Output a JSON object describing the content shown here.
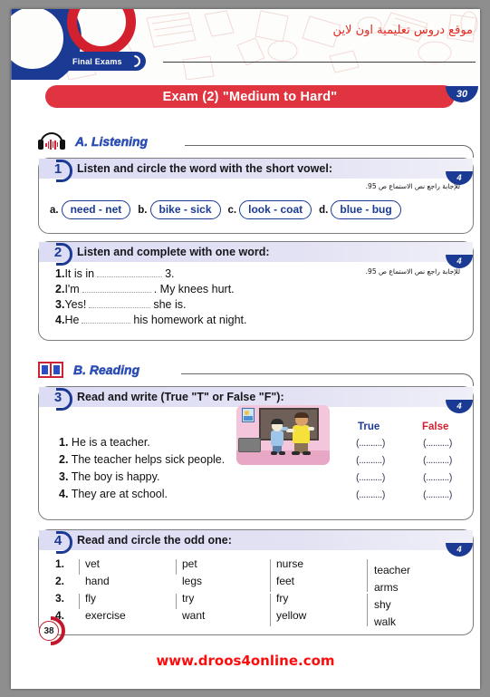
{
  "header": {
    "tab_label": "Final Exams",
    "arabic_site_text": "موقع دروس تعليمية اون لاين",
    "exam_title": "Exam (2) \"Medium to Hard\"",
    "total_mark": "30"
  },
  "sections": [
    {
      "id": "listening",
      "label": "A. Listening",
      "icon": "headphones-icon"
    },
    {
      "id": "reading",
      "label": "B. Reading",
      "icon": "open-book-icon"
    }
  ],
  "questions": {
    "q1": {
      "number": "1",
      "prompt": "Listen and circle the word with the short vowel:",
      "mark": "4",
      "arabic_note": "للإجابة راجع نص الاستماع ص 95.",
      "options": [
        {
          "letter": "a.",
          "text": "need - net"
        },
        {
          "letter": "b.",
          "text": "bike - sick"
        },
        {
          "letter": "c.",
          "text": "look - coat"
        },
        {
          "letter": "d.",
          "text": "blue - bug"
        }
      ]
    },
    "q2": {
      "number": "2",
      "prompt": "Listen and complete with one word:",
      "mark": "4",
      "arabic_note": "للإجابة راجع نص الاستماع ص 95.",
      "items": [
        {
          "num": "1.",
          "before": "It is in",
          "after": "3."
        },
        {
          "num": "2.",
          "before": "I'm",
          "after": ". My knees hurt."
        },
        {
          "num": "3.",
          "before": "Yes!",
          "after": "she is."
        },
        {
          "num": "4.",
          "before": "He",
          "after": "his homework at night."
        }
      ]
    },
    "q3": {
      "number": "3",
      "prompt": "Read and write (True \"T\" or False \"F\"):",
      "mark": "4",
      "col_true": "True",
      "col_false": "False",
      "answer_cell": "(..........)",
      "statements": [
        {
          "num": "1.",
          "text": "He is a teacher."
        },
        {
          "num": "2.",
          "text": "The teacher helps sick people."
        },
        {
          "num": "3.",
          "text": "The boy is happy."
        },
        {
          "num": "4.",
          "text": "They are at school."
        }
      ]
    },
    "q4": {
      "number": "4",
      "prompt": "Read and circle the odd one:",
      "mark": "4",
      "rows": [
        {
          "num": "1.",
          "w1": "vet",
          "w2": "pet",
          "w3": "nurse",
          "w4": "teacher"
        },
        {
          "num": "2.",
          "w1": "hand",
          "w2": "legs",
          "w3": "feet",
          "w4": "arms"
        },
        {
          "num": "3.",
          "w1": "fly",
          "w2": "try",
          "w3": "fry",
          "w4": "shy"
        },
        {
          "num": "4.",
          "w1": "exercise",
          "w2": "want",
          "w3": "yellow",
          "w4": "walk"
        }
      ]
    }
  },
  "footer": {
    "page_number": "38",
    "website": "www.droos4online.com"
  },
  "colors": {
    "navy": "#1b3a94",
    "red": "#d2202f",
    "banner_red": "#e03541",
    "highlight_yellow": "#ffe24a",
    "url_red": "#fb0d0d"
  }
}
